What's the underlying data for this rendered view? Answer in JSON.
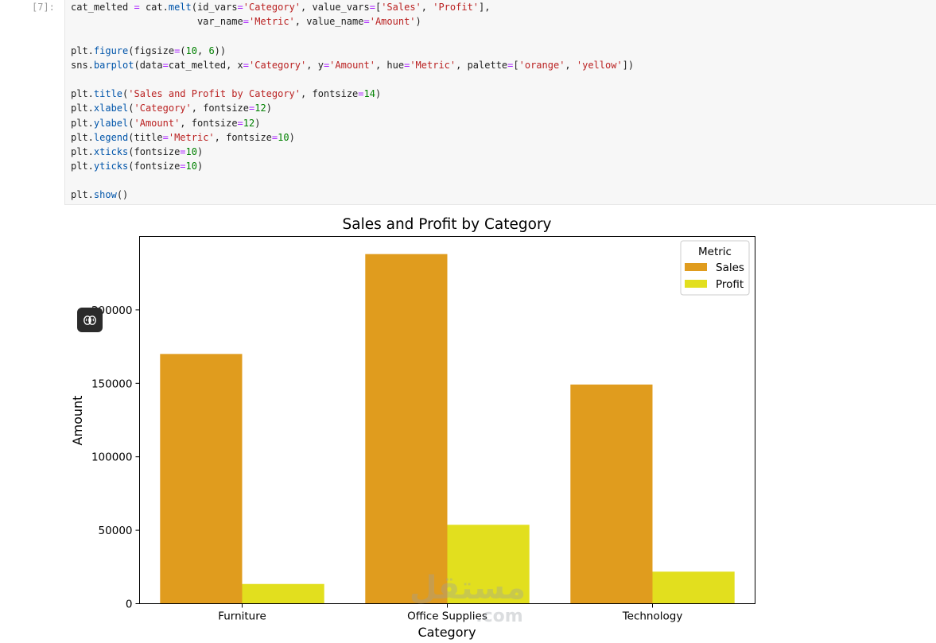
{
  "cell": {
    "prompt": "[7]:",
    "code_lines": [
      [
        {
          "t": "cat_melted "
        },
        {
          "t": "=",
          "c": "o"
        },
        {
          "t": " cat."
        },
        {
          "t": "melt",
          "c": "f"
        },
        {
          "t": "(id_vars"
        },
        {
          "t": "=",
          "c": "o"
        },
        {
          "t": "'Category'",
          "c": "s"
        },
        {
          "t": ", value_vars"
        },
        {
          "t": "=",
          "c": "o"
        },
        {
          "t": "["
        },
        {
          "t": "'Sales'",
          "c": "s"
        },
        {
          "t": ", "
        },
        {
          "t": "'Profit'",
          "c": "s"
        },
        {
          "t": "],"
        }
      ],
      [
        {
          "t": "                      var_name"
        },
        {
          "t": "=",
          "c": "o"
        },
        {
          "t": "'Metric'",
          "c": "s"
        },
        {
          "t": ", value_name"
        },
        {
          "t": "=",
          "c": "o"
        },
        {
          "t": "'Amount'",
          "c": "s"
        },
        {
          "t": ")"
        }
      ],
      [],
      [
        {
          "t": "plt."
        },
        {
          "t": "figure",
          "c": "f"
        },
        {
          "t": "(figsize"
        },
        {
          "t": "=",
          "c": "o"
        },
        {
          "t": "("
        },
        {
          "t": "10",
          "c": "n"
        },
        {
          "t": ", "
        },
        {
          "t": "6",
          "c": "n"
        },
        {
          "t": "))"
        }
      ],
      [
        {
          "t": "sns."
        },
        {
          "t": "barplot",
          "c": "f"
        },
        {
          "t": "(data"
        },
        {
          "t": "=",
          "c": "o"
        },
        {
          "t": "cat_melted, x"
        },
        {
          "t": "=",
          "c": "o"
        },
        {
          "t": "'Category'",
          "c": "s"
        },
        {
          "t": ", y"
        },
        {
          "t": "=",
          "c": "o"
        },
        {
          "t": "'Amount'",
          "c": "s"
        },
        {
          "t": ", hue"
        },
        {
          "t": "=",
          "c": "o"
        },
        {
          "t": "'Metric'",
          "c": "s"
        },
        {
          "t": ", palette"
        },
        {
          "t": "=",
          "c": "o"
        },
        {
          "t": "["
        },
        {
          "t": "'orange'",
          "c": "s"
        },
        {
          "t": ", "
        },
        {
          "t": "'yellow'",
          "c": "s"
        },
        {
          "t": "])"
        }
      ],
      [],
      [
        {
          "t": "plt."
        },
        {
          "t": "title",
          "c": "f"
        },
        {
          "t": "("
        },
        {
          "t": "'Sales and Profit by Category'",
          "c": "s"
        },
        {
          "t": ", fontsize"
        },
        {
          "t": "=",
          "c": "o"
        },
        {
          "t": "14",
          "c": "n"
        },
        {
          "t": ")"
        }
      ],
      [
        {
          "t": "plt."
        },
        {
          "t": "xlabel",
          "c": "f"
        },
        {
          "t": "("
        },
        {
          "t": "'Category'",
          "c": "s"
        },
        {
          "t": ", fontsize"
        },
        {
          "t": "=",
          "c": "o"
        },
        {
          "t": "12",
          "c": "n"
        },
        {
          "t": ")"
        }
      ],
      [
        {
          "t": "plt."
        },
        {
          "t": "ylabel",
          "c": "f"
        },
        {
          "t": "("
        },
        {
          "t": "'Amount'",
          "c": "s"
        },
        {
          "t": ", fontsize"
        },
        {
          "t": "=",
          "c": "o"
        },
        {
          "t": "12",
          "c": "n"
        },
        {
          "t": ")"
        }
      ],
      [
        {
          "t": "plt."
        },
        {
          "t": "legend",
          "c": "f"
        },
        {
          "t": "(title"
        },
        {
          "t": "=",
          "c": "o"
        },
        {
          "t": "'Metric'",
          "c": "s"
        },
        {
          "t": ", fontsize"
        },
        {
          "t": "=",
          "c": "o"
        },
        {
          "t": "10",
          "c": "n"
        },
        {
          "t": ")"
        }
      ],
      [
        {
          "t": "plt."
        },
        {
          "t": "xticks",
          "c": "f"
        },
        {
          "t": "(fontsize"
        },
        {
          "t": "=",
          "c": "o"
        },
        {
          "t": "10",
          "c": "n"
        },
        {
          "t": ")"
        }
      ],
      [
        {
          "t": "plt."
        },
        {
          "t": "yticks",
          "c": "f"
        },
        {
          "t": "(fontsize"
        },
        {
          "t": "=",
          "c": "o"
        },
        {
          "t": "10",
          "c": "n"
        },
        {
          "t": ")"
        }
      ],
      [],
      [
        {
          "t": "plt."
        },
        {
          "t": "show",
          "c": "f"
        },
        {
          "t": "()"
        }
      ]
    ]
  },
  "overlay": {
    "brain_icon": "brain-icon",
    "watermark_text": "مستقل",
    "watermark_sub": ".com"
  },
  "chart_data": {
    "type": "bar",
    "title": "Sales and Profit by Category",
    "xlabel": "Category",
    "ylabel": "Amount",
    "categories": [
      "Furniture",
      "Office Supplies",
      "Technology"
    ],
    "series": [
      {
        "name": "Sales",
        "values": [
          170000,
          238000,
          149200
        ],
        "color": "#e09c1e"
      },
      {
        "name": "Profit",
        "values": [
          13400,
          53700,
          21800
        ],
        "color": "#e2df1e"
      }
    ],
    "ylim": [
      0,
      250000
    ],
    "yticks": [
      0,
      50000,
      100000,
      150000,
      200000
    ],
    "ytick_labels": [
      "0",
      "50000",
      "100000",
      "150000",
      "200000"
    ],
    "legend": {
      "title": "Metric",
      "placement": "top-right"
    },
    "grid": false
  }
}
